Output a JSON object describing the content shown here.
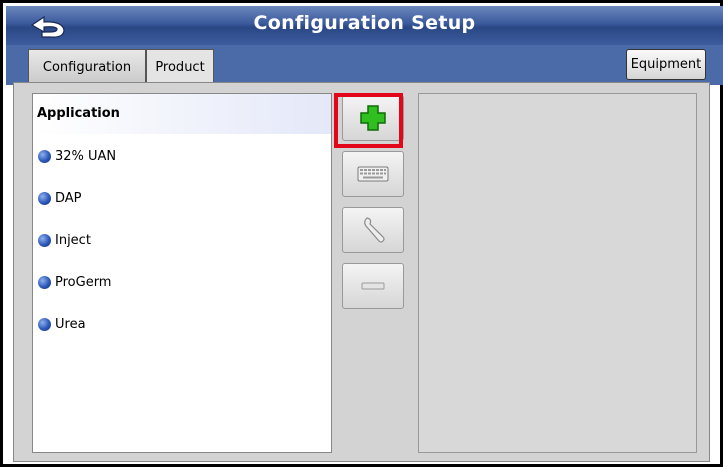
{
  "header": {
    "title": "Configuration Setup",
    "back_icon": "back-arrow-icon"
  },
  "tabs": [
    {
      "label": "Configuration",
      "selected": false
    },
    {
      "label": "Product",
      "selected": true
    }
  ],
  "equipment_button": {
    "label": "Equipment"
  },
  "product_list": {
    "header": "Application",
    "items": [
      "32% UAN",
      "DAP",
      "Inject",
      "ProGerm",
      "Urea"
    ]
  },
  "tools": [
    {
      "icon": "add-icon",
      "enabled": true,
      "highlighted": true
    },
    {
      "icon": "keyboard-icon",
      "enabled": false
    },
    {
      "icon": "wrench-icon",
      "enabled": false
    },
    {
      "icon": "remove-icon",
      "enabled": false
    }
  ],
  "colors": {
    "title_bar": "#3b5a9c",
    "highlight": "#e3061b",
    "add_icon": "#2fbf1f",
    "item_dot": "#2c57b8"
  }
}
